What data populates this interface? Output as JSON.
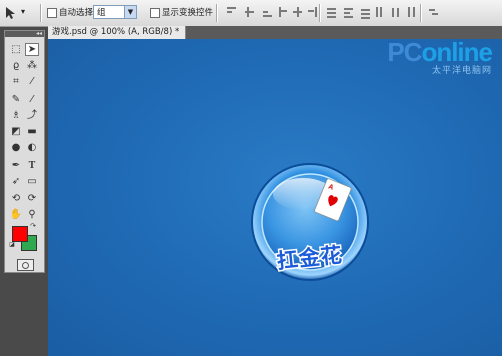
{
  "options_bar": {
    "auto_select_label": "自动选择:",
    "auto_select_value": "组",
    "show_transform_label": "显示变换控件"
  },
  "tools_panel": {
    "collapse_label": "◂◂"
  },
  "document": {
    "tab_title": "游戏.psd @ 100% (A, RGB/8) *"
  },
  "canvas": {
    "brand_name_prefix": "PC",
    "brand_name_suffix": "online",
    "brand_sub": "太平洋电脑网",
    "logo_text": "扛金花",
    "card_rank": "A"
  },
  "colors": {
    "canvas_blue": "#1f69b3",
    "foreground": "#ff0000",
    "background": "#2fa84f"
  }
}
